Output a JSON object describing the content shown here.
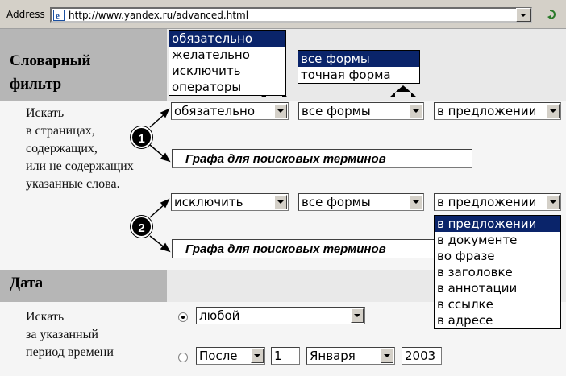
{
  "address_bar": {
    "label": "Address",
    "url": "http://www.yandex.ru/advanced.html"
  },
  "word_filter": {
    "title_line1": "Словарный",
    "title_line2": "фильтр",
    "description": [
      "Искать",
      "в страницах,",
      "содержащих,",
      "или не содержащих",
      "указанные слова."
    ],
    "row1": {
      "badge": "1",
      "requirement": "обязательно",
      "forms": "все формы",
      "scope": "в предложении",
      "search_terms": "Графа для поисковых терминов"
    },
    "row2": {
      "badge": "2",
      "requirement": "исключить",
      "forms": "все формы",
      "scope": "в предложении",
      "search_terms": "Графа для поисковых терминов"
    },
    "requirement_options": [
      "обязательно",
      "желательно",
      "исключить",
      "операторы"
    ],
    "forms_options": [
      "все формы",
      "точная форма"
    ],
    "scope_options": [
      "в предложении",
      "в документе",
      "во фразе",
      "в заголовке",
      "в аннотации",
      "в ссылке",
      "в адресе"
    ]
  },
  "date_filter": {
    "title": "Дата",
    "description": [
      "Искать",
      "за указанный",
      "период времени"
    ],
    "option_any": "любой",
    "option_after": "После",
    "day": "1",
    "month": "Января",
    "year": "2003",
    "selected": "любой"
  },
  "colors": {
    "header_bg": "#b6b6b6",
    "selection": "#0a246a"
  }
}
